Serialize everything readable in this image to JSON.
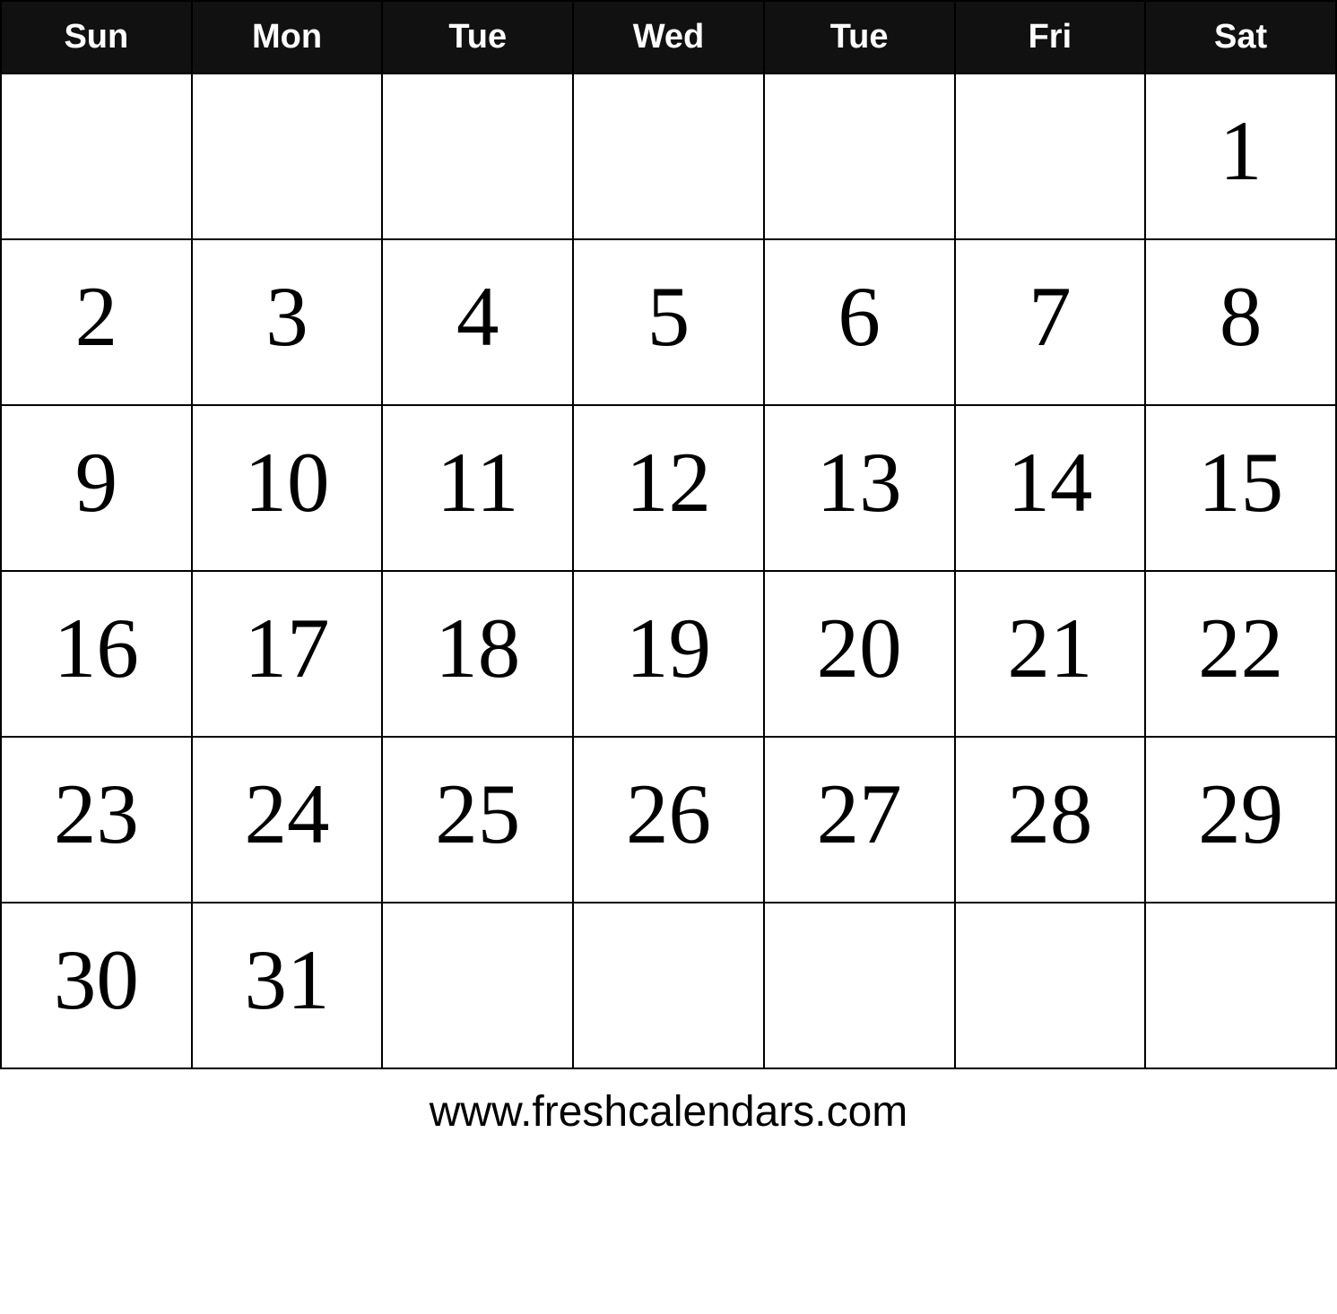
{
  "calendar": {
    "header": {
      "days": [
        "Sun",
        "Mon",
        "Tue",
        "Wed",
        "Tue",
        "Fri",
        "Sat"
      ]
    },
    "weeks": [
      [
        "",
        "",
        "",
        "",
        "",
        "",
        "1"
      ],
      [
        "2",
        "3",
        "4",
        "5",
        "6",
        "7",
        "8"
      ],
      [
        "9",
        "10",
        "11",
        "12",
        "13",
        "14",
        "15"
      ],
      [
        "16",
        "17",
        "18",
        "19",
        "20",
        "21",
        "22"
      ],
      [
        "23",
        "24",
        "25",
        "26",
        "27",
        "28",
        "29"
      ],
      [
        "30",
        "31",
        "",
        "",
        "",
        "",
        ""
      ]
    ],
    "footer": "www.freshcalendars.com"
  }
}
